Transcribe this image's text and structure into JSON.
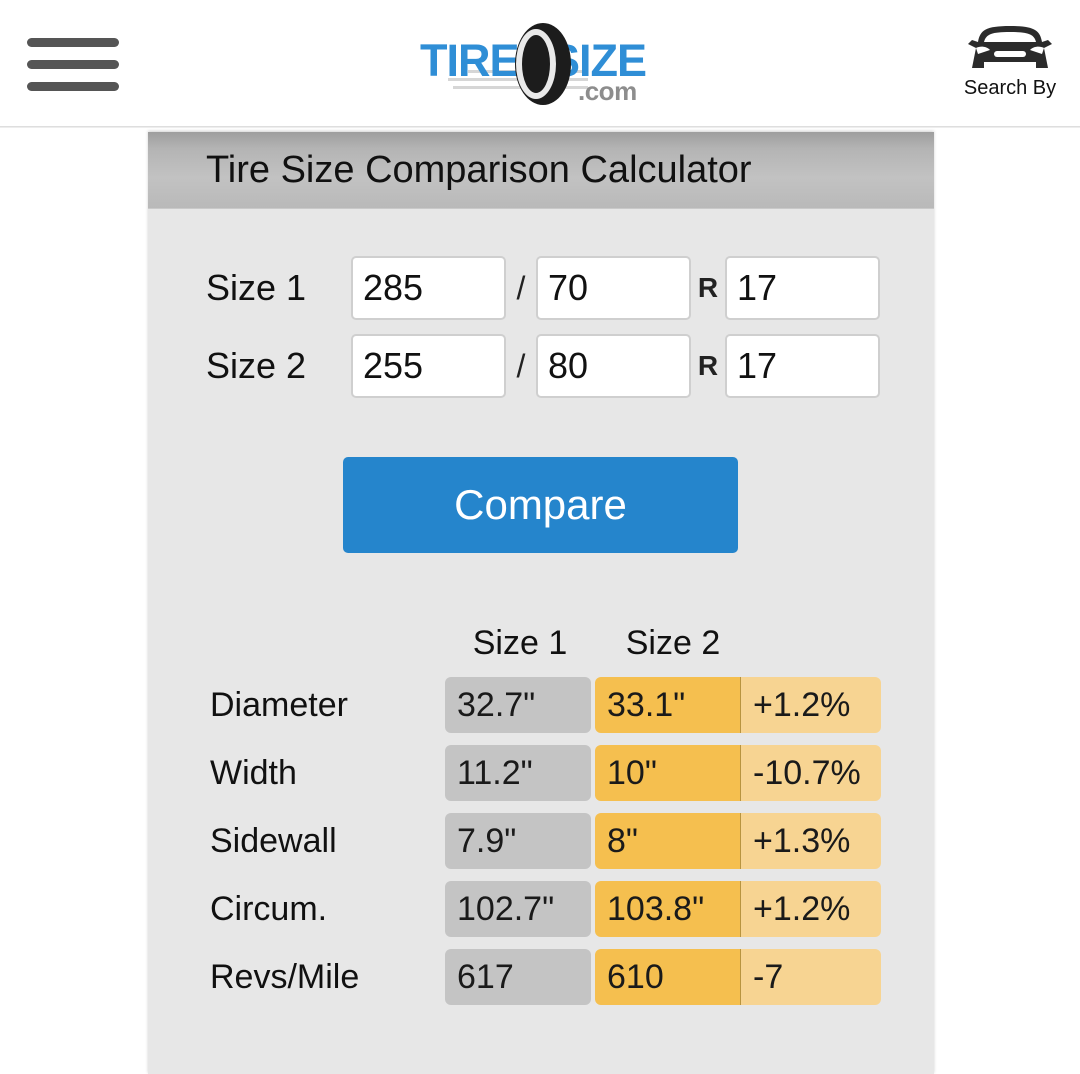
{
  "header": {
    "menu_icon": "hamburger-menu-icon",
    "logo": {
      "word_left": "TIRE",
      "word_right": "SIZE",
      "suffix": ".com",
      "tire_icon": "tire-icon",
      "brand_color": "#2f8ed6",
      "suffix_color": "#8d8d8d"
    },
    "search_by": {
      "icon": "car-front-icon",
      "label": "Search By"
    }
  },
  "remnant_text": "",
  "card": {
    "title": "Tire Size Comparison Calculator",
    "inputs": {
      "separator": "/",
      "radial_marker": "R",
      "rows": [
        {
          "label": "Size 1",
          "width": "285",
          "ratio": "70",
          "rim": "17"
        },
        {
          "label": "Size 2",
          "width": "255",
          "ratio": "80",
          "rim": "17"
        }
      ],
      "placeholders": {
        "width": "",
        "ratio": "",
        "rim": ""
      }
    },
    "compare_button": {
      "label": "Compare",
      "color": "#2585cc"
    },
    "results": {
      "col_headers": [
        "Size 1",
        "Size 2"
      ],
      "colors": {
        "size1_cell": "#c4c4c4",
        "size2_cell": "#f5bf4f",
        "diff_cell": "#f7d492"
      },
      "rows": [
        {
          "label": "Diameter",
          "size1": "32.7\"",
          "size2": "33.1\"",
          "diff": "+1.2%"
        },
        {
          "label": "Width",
          "size1": "11.2\"",
          "size2": "10\"",
          "diff": "-10.7%"
        },
        {
          "label": "Sidewall",
          "size1": "7.9\"",
          "size2": "8\"",
          "diff": "+1.3%"
        },
        {
          "label": "Circum.",
          "size1": "102.7\"",
          "size2": "103.8\"",
          "diff": "+1.2%"
        },
        {
          "label": "Revs/Mile",
          "size1": "617",
          "size2": "610",
          "diff": "-7"
        }
      ]
    }
  }
}
